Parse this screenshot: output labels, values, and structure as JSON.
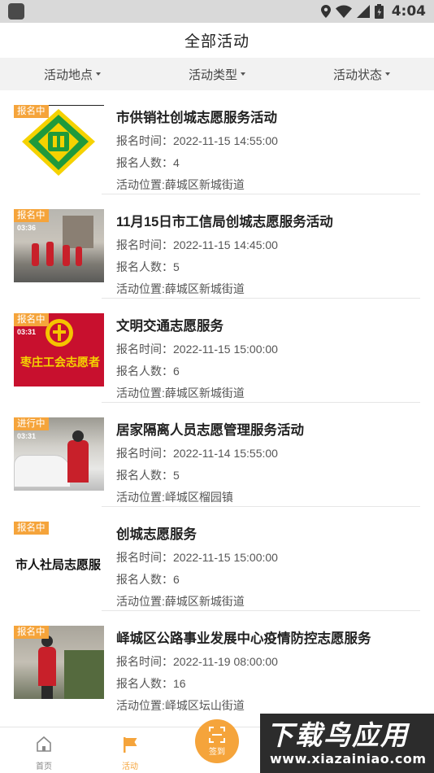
{
  "status_bar": {
    "time": "4:04"
  },
  "header": {
    "title": "全部活动"
  },
  "filters": [
    {
      "label": "活动地点"
    },
    {
      "label": "活动类型"
    },
    {
      "label": "活动状态"
    }
  ],
  "activities": [
    {
      "status": "报名中",
      "title": "市供销社创城志愿服务活动",
      "time": "报名时间：2022-11-15 14:55:00",
      "count": "报名人数：4",
      "location": "活动位置:薛城区新城街道",
      "thumb": "logo"
    },
    {
      "status": "报名中",
      "title": "11月15日市工信局创城志愿服务活动",
      "time": "报名时间：2022-11-15 14:45:00",
      "count": "报名人数：5",
      "location": "活动位置:薛城区新城街道",
      "thumb_time": "03:36",
      "thumb": "photo"
    },
    {
      "status": "报名中",
      "title": "文明交通志愿服务",
      "time": "报名时间：2022-11-15 15:00:00",
      "count": "报名人数：6",
      "location": "活动位置:薛城区新城街道",
      "thumb_time": "03:31",
      "thumb_text": "枣庄工会志愿者",
      "thumb": "banner"
    },
    {
      "status": "进行中",
      "title": "居家隔离人员志愿管理服务活动",
      "time": "报名时间：2022-11-14 15:55:00",
      "count": "报名人数：5",
      "location": "活动位置:峄城区榴园镇",
      "thumb_time": "03:31",
      "thumb": "photo"
    },
    {
      "status": "报名中",
      "title": "创城志愿服务",
      "time": "报名时间：2022-11-15 15:00:00",
      "count": "报名人数：6",
      "location": "活动位置:薛城区新城街道",
      "thumb_text": "市人社局志愿服",
      "thumb": "text"
    },
    {
      "status": "报名中",
      "title": "峄城区公路事业发展中心疫情防控志愿服务",
      "time": "报名时间：2022-11-19 08:00:00",
      "count": "报名人数：16",
      "location": "活动位置:峄城区坛山街道",
      "thumb": "photo"
    }
  ],
  "tabbar": {
    "home_label": "首页",
    "activity_label": "活动",
    "signin_label": "签到"
  },
  "watermark": {
    "big_text": "下载鸟应用",
    "url_text": "www.xiazainiao.com"
  },
  "colors": {
    "accent": "#f5a43b",
    "logo_green": "#1f9a3c",
    "logo_yellow": "#f5d200",
    "banner_red": "#c8102e"
  }
}
